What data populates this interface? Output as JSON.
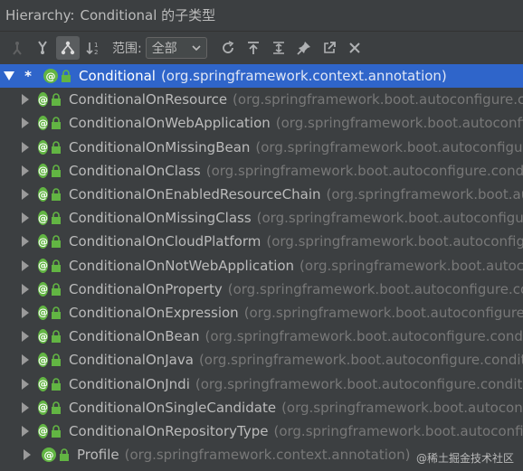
{
  "header": {
    "prefix": "Hierarchy:",
    "title": "Conditional 的子类型"
  },
  "toolbar": {
    "scope_label": "范围:",
    "scope_value": "全部"
  },
  "tree": {
    "root": {
      "marker": "*",
      "name": "Conditional",
      "package": "(org.springframework.context.annotation)"
    },
    "children": [
      {
        "name": "ConditionalOnResource",
        "package": "(org.springframework.boot.autoconfigure.condition)"
      },
      {
        "name": "ConditionalOnWebApplication",
        "package": "(org.springframework.boot.autoconfigure.condition)"
      },
      {
        "name": "ConditionalOnMissingBean",
        "package": "(org.springframework.boot.autoconfigure.condition)"
      },
      {
        "name": "ConditionalOnClass",
        "package": "(org.springframework.boot.autoconfigure.condition)"
      },
      {
        "name": "ConditionalOnEnabledResourceChain",
        "package": "(org.springframework.boot.autoconfigure.web)"
      },
      {
        "name": "ConditionalOnMissingClass",
        "package": "(org.springframework.boot.autoconfigure.condition)"
      },
      {
        "name": "ConditionalOnCloudPlatform",
        "package": "(org.springframework.boot.autoconfigure.condition)"
      },
      {
        "name": "ConditionalOnNotWebApplication",
        "package": "(org.springframework.boot.autoconfigure.condition)"
      },
      {
        "name": "ConditionalOnProperty",
        "package": "(org.springframework.boot.autoconfigure.condition)"
      },
      {
        "name": "ConditionalOnExpression",
        "package": "(org.springframework.boot.autoconfigure.condition)"
      },
      {
        "name": "ConditionalOnBean",
        "package": "(org.springframework.boot.autoconfigure.condition)"
      },
      {
        "name": "ConditionalOnJava",
        "package": "(org.springframework.boot.autoconfigure.condition)"
      },
      {
        "name": "ConditionalOnJndi",
        "package": "(org.springframework.boot.autoconfigure.condition)"
      },
      {
        "name": "ConditionalOnSingleCandidate",
        "package": "(org.springframework.boot.autoconfigure.condition)"
      },
      {
        "name": "ConditionalOnRepositoryType",
        "package": "(org.springframework.boot.autoconfigure.data)"
      },
      {
        "name": "Profile",
        "package": "(org.springframework.context.annotation)"
      }
    ]
  },
  "watermark": "@稀土掘金技术社区",
  "colors": {
    "background": "#3c3f41",
    "selection": "#2f65ca",
    "annotation_icon": "#62b543",
    "lock_icon": "#62b543"
  },
  "icons": [
    "subtypes-icon",
    "supertypes-icon",
    "hierarchy-icon",
    "sort-alpha-icon",
    "refresh-icon",
    "export-icon",
    "expand-all-icon",
    "pin-icon",
    "open-in-new-icon",
    "close-icon"
  ]
}
